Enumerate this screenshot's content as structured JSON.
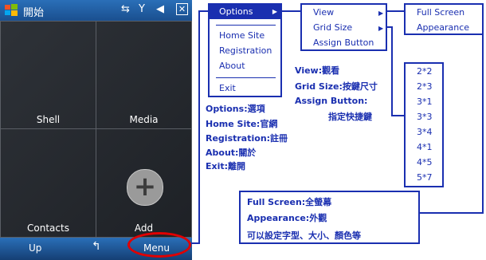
{
  "phone": {
    "title": "開始",
    "tiles": [
      "Shell",
      "Media",
      "Contacts",
      "Add"
    ],
    "plus_glyph": "+",
    "softkeys": {
      "left": "Up",
      "middle": "↰",
      "right": "Menu"
    }
  },
  "menus": {
    "options": {
      "header": "Options",
      "items": [
        "Home Site",
        "Registration",
        "About",
        "Exit"
      ]
    },
    "options_submenu": [
      "View",
      "Grid Size",
      "Assign Button"
    ],
    "view_submenu": [
      "Full Screen",
      "Appearance"
    ],
    "grid_sizes": [
      "2*2",
      "2*3",
      "3*1",
      "3*3",
      "3*4",
      "4*1",
      "4*5",
      "5*7"
    ]
  },
  "annotations": {
    "options_cn": [
      "Options:選項",
      "Home Site:官網",
      "Registration:註冊",
      "About:關於",
      "Exit:離開"
    ],
    "submenu_cn": [
      "View:觀看",
      "Grid Size:按鍵尺寸",
      "Assign Button:",
      "指定快捷鍵"
    ],
    "view_cn": [
      "Full Screen:全螢幕",
      "Appearance:外觀",
      "可以設定字型、大小、顏色等"
    ]
  },
  "colors": {
    "accent": "#1a2fb0",
    "highlight_ring": "#e00000"
  }
}
